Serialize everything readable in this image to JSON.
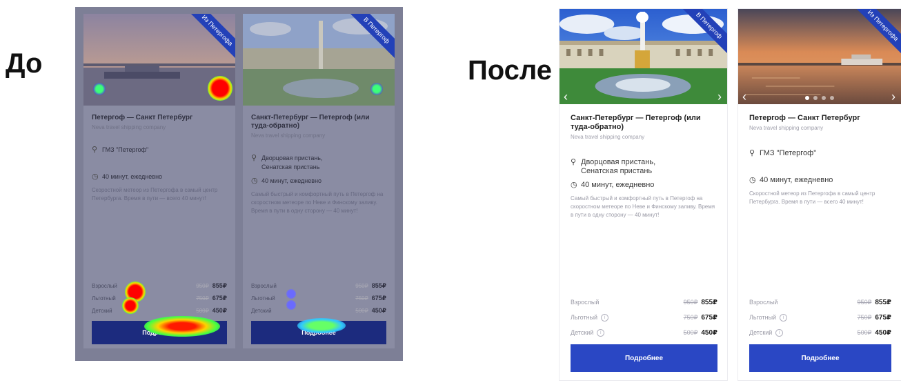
{
  "labels": {
    "before": "До",
    "after": "После"
  },
  "colors": {
    "button": "#2a47c4",
    "ribbon": "#2341b8",
    "heatmap_hot": "#ff0000",
    "heatmap_cool": "#3b3bff"
  },
  "before_cards": [
    {
      "ribbon": "Из Петергофа",
      "title": "Петергоф — Санкт Петербург",
      "company": "Neva travel shipping company",
      "place_line1": "ГМЗ \"Петергоф\"",
      "place_line2": "",
      "duration": "40 минут, ежедневно",
      "description": "Скоростной метеор из Петергофа в самый центр Петербурга. Время в пути — всего 40 минут!",
      "prices": [
        {
          "name": "Взрослый",
          "old": "950₽",
          "new": "855₽"
        },
        {
          "name": "Льготный",
          "old": "750₽",
          "new": "675₽"
        },
        {
          "name": "Детский",
          "old": "500₽",
          "new": "450₽"
        }
      ],
      "button": "Подробнее"
    },
    {
      "ribbon": "В Петергоф",
      "title": "Санкт-Петербург — Петергоф (или туда-обратно)",
      "company": "Neva travel shipping company",
      "place_line1": "Дворцовая пристань,",
      "place_line2": "Сенатская пристань",
      "duration": "40 минут, ежедневно",
      "description": "Самый быстрый и комфортный путь в Петергоф на скоростном метеоре по Неве и Финскому заливу. Время в пути в одну сторону — 40 минут!",
      "prices": [
        {
          "name": "Взрослый",
          "old": "950₽",
          "new": "855₽"
        },
        {
          "name": "Льготный",
          "old": "750₽",
          "new": "675₽"
        },
        {
          "name": "Детский",
          "old": "500₽",
          "new": "450₽"
        }
      ],
      "button": "Подробнее"
    }
  ],
  "after_cards": [
    {
      "ribbon": "В Петергоф",
      "title": "Санкт-Петербург — Петергоф (или туда-обратно)",
      "company": "Neva travel shipping company",
      "place_line1": "Дворцовая пристань,",
      "place_line2": "Сенатская пристань",
      "duration": "40 минут, ежедневно",
      "description": "Самый быстрый и комфортный путь в Петергоф на скоростном метеоре по Неве и Финскому заливу. Время в пути в одну сторону — 40 минут!",
      "prices": [
        {
          "name": "Взрослый",
          "old": "950₽",
          "new": "855₽"
        },
        {
          "name": "Льготный",
          "old": "750₽",
          "new": "675₽"
        },
        {
          "name": "Детский",
          "old": "500₽",
          "new": "450₽"
        }
      ],
      "button": "Подробнее"
    },
    {
      "ribbon": "Из Петергофа",
      "title": "Петергоф — Санкт Петербург",
      "company": "Neva travel shipping company",
      "place_line1": "ГМЗ \"Петергоф\"",
      "place_line2": "",
      "duration": "40 минут, ежедневно",
      "description": "Скоростной метеор из Петергофа в самый центр Петербурга. Время в пути — всего 40 минут!",
      "prices": [
        {
          "name": "Взрослый",
          "old": "950₽",
          "new": "855₽"
        },
        {
          "name": "Льготный",
          "old": "750₽",
          "new": "675₽"
        },
        {
          "name": "Детский",
          "old": "500₽",
          "new": "450₽"
        }
      ],
      "button": "Подробнее"
    }
  ]
}
